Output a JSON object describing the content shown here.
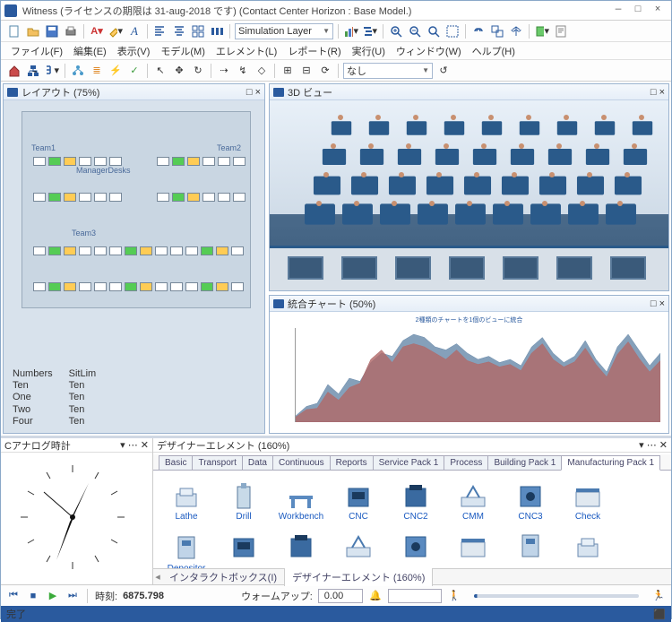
{
  "title": "Witness (ライセンスの期限は 31-aug-2018 です) (Contact Center Horizon : Base Model.)",
  "menu": {
    "file": "ファイル(F)",
    "edit": "編集(E)",
    "view": "表示(V)",
    "model": "モデル(M)",
    "elements": "エレメント(L)",
    "reports": "レポート(R)",
    "run": "実行(U)",
    "window": "ウィンドウ(W)",
    "help": "ヘルプ(H)"
  },
  "toolbar1": {
    "font": "A",
    "layer_combo": "Simulation Layer"
  },
  "toolbar3": {
    "combo": "なし"
  },
  "panes": {
    "layout": {
      "title": "レイアウト (75%)",
      "teams": [
        "Team1",
        "Team2",
        "Team3"
      ],
      "mgr": "ManagerDesks",
      "legend": {
        "col1": [
          "Numbers",
          "Ten",
          "One",
          "Two",
          "Four"
        ],
        "col2": [
          "SitLim",
          "Ten",
          "Ten",
          "Ten",
          "Ten"
        ]
      }
    },
    "view3d": {
      "title": "3D ビュー"
    },
    "chart": {
      "title": "統合チャート (50%)",
      "small": "2種類のチャートを1個のビューに統合"
    }
  },
  "chart_data": {
    "type": "area",
    "x_range": [
      0,
      7000
    ],
    "ylim": [
      0,
      150
    ],
    "y_ticks": [
      0,
      10,
      20,
      30,
      40,
      50,
      60,
      70,
      80,
      90,
      100,
      110,
      120,
      130,
      140,
      150
    ],
    "series": [
      {
        "name": "blue",
        "color": "#6a8aaad0",
        "values": [
          10,
          25,
          30,
          60,
          45,
          70,
          65,
          95,
          110,
          105,
          130,
          140,
          135,
          120,
          115,
          125,
          110,
          100,
          105,
          95,
          100,
          90,
          120,
          135,
          110,
          95,
          105,
          130,
          100,
          80,
          120,
          140,
          115,
          90,
          110
        ]
      },
      {
        "name": "red",
        "color": "#b06a6ad0",
        "values": [
          8,
          20,
          22,
          48,
          35,
          55,
          62,
          100,
          115,
          95,
          120,
          125,
          120,
          110,
          100,
          115,
          98,
          92,
          96,
          88,
          92,
          82,
          110,
          125,
          100,
          88,
          96,
          118,
          92,
          72,
          108,
          128,
          102,
          80,
          98
        ]
      }
    ]
  },
  "clock": {
    "title": "Cアナログ時計"
  },
  "designer": {
    "title": "デザイナーエレメント (160%)",
    "tabs": [
      "Basic",
      "Transport",
      "Data",
      "Continuous",
      "Reports",
      "Service Pack 1",
      "Process",
      "Building Pack 1",
      "Manufacturing Pack 1"
    ],
    "active_tab": "Manufacturing Pack 1",
    "elements": [
      "Lathe",
      "Drill",
      "Workbench",
      "CNC",
      "CNC2",
      "CMM",
      "CNC3",
      "Check",
      "Depositor"
    ],
    "bottom_tabs": {
      "interact": "インタラクトボックス(I)",
      "designer": "デザイナーエレメント (160%)"
    }
  },
  "playbar": {
    "time_label": "時刻:",
    "time_value": "6875.798",
    "warmup_label": "ウォームアップ:",
    "warmup_value": "0.00"
  },
  "status": "完了",
  "colors": {
    "accent": "#2a5a9e",
    "green": "#3aaa3a",
    "orange": "#e08a2a"
  }
}
